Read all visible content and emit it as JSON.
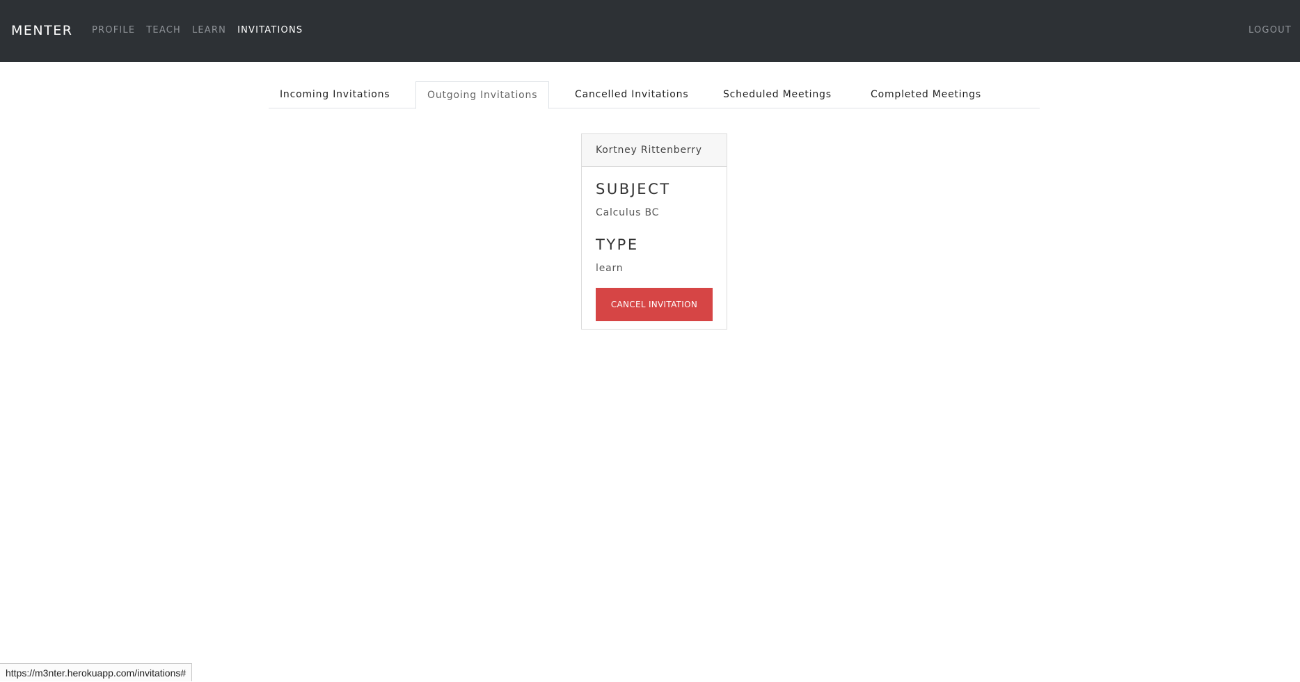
{
  "navbar": {
    "brand": "MENTER",
    "links": [
      {
        "label": "PROFILE",
        "active": false
      },
      {
        "label": "TEACH",
        "active": false
      },
      {
        "label": "LEARN",
        "active": false
      },
      {
        "label": "INVITATIONS",
        "active": true
      }
    ],
    "logout": "LOGOUT",
    "background": "#2d3135"
  },
  "tabs": [
    {
      "label": "Incoming Invitations",
      "active": false
    },
    {
      "label": "Outgoing Invitations",
      "active": true
    },
    {
      "label": "Cancelled Invitations",
      "active": false
    },
    {
      "label": "Scheduled Meetings",
      "active": false
    },
    {
      "label": "Completed Meetings",
      "active": false
    }
  ],
  "invitation_card": {
    "name": "Kortney Rittenberry",
    "subject_heading": "SUBJECT",
    "subject_value": "Calculus BC",
    "type_heading": "TYPE",
    "type_value": "learn",
    "cancel_button": "CANCEL INVITATION",
    "cancel_color": "#d64545"
  },
  "status_bar": {
    "url": "https://m3nter.herokuapp.com/invitations#"
  }
}
